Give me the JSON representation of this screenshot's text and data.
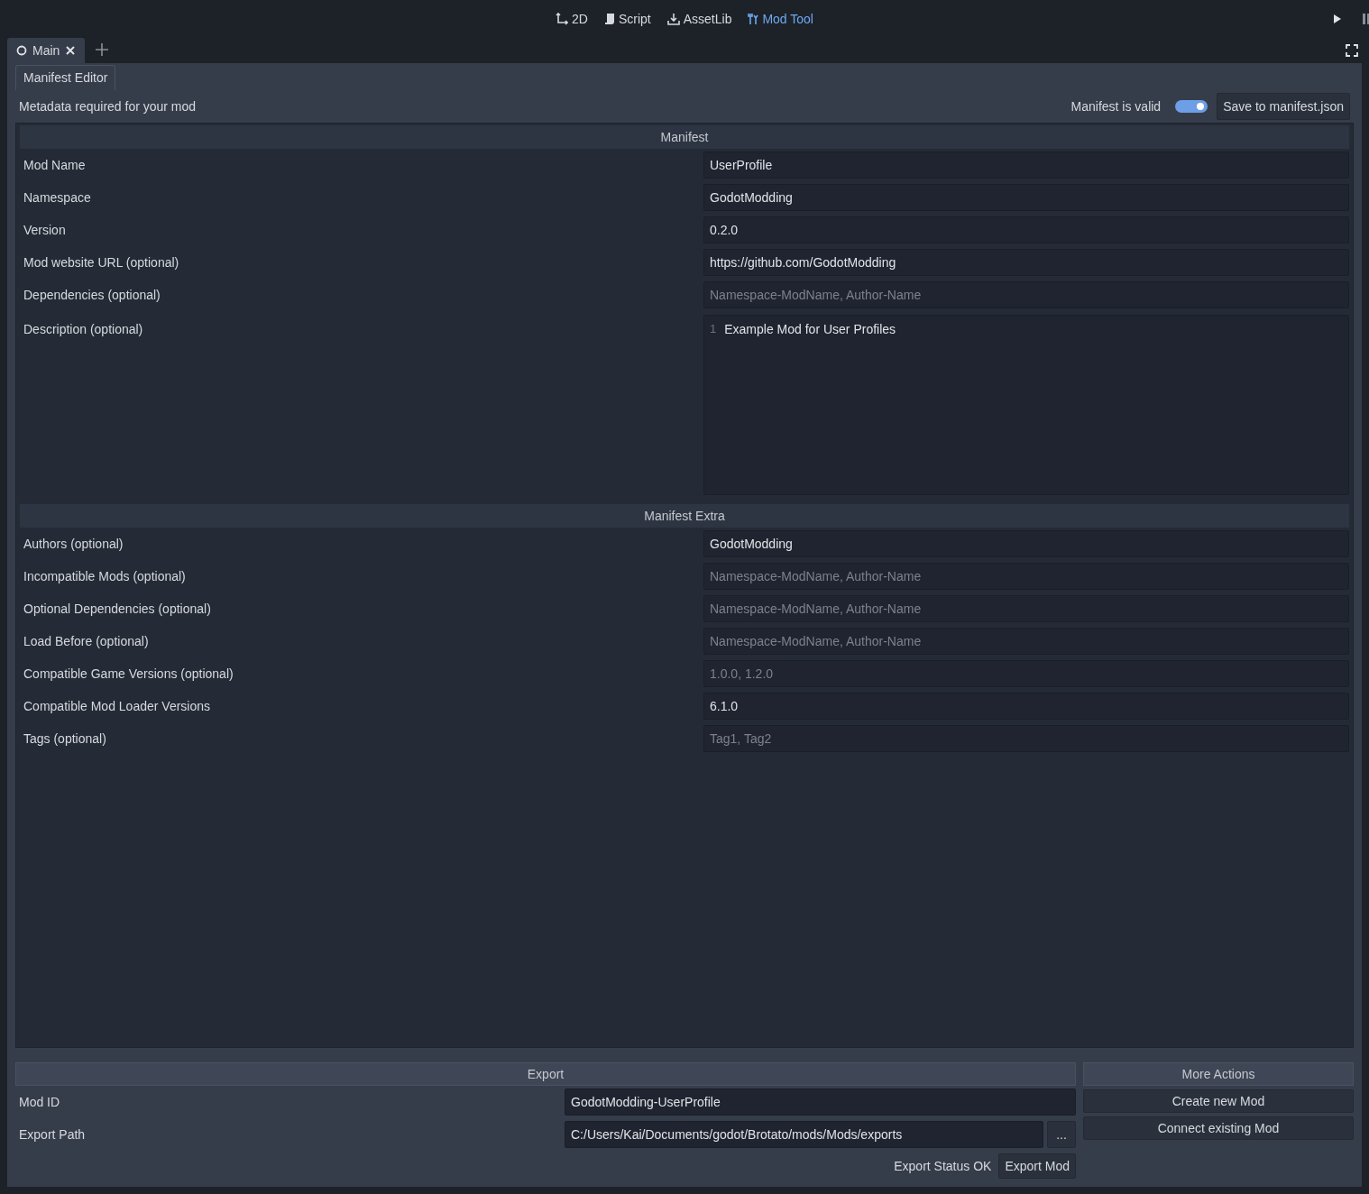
{
  "toolbar": {
    "items": [
      {
        "label": "2D",
        "kind": "axes",
        "selected": false
      },
      {
        "label": "Script",
        "kind": "script",
        "selected": false
      },
      {
        "label": "AssetLib",
        "kind": "assetlib",
        "selected": false
      },
      {
        "label": "Mod Tool",
        "kind": "modtool",
        "selected": true
      }
    ]
  },
  "scene_tabs": [
    {
      "label": "Main",
      "selected": true
    }
  ],
  "editor_tabs": [
    {
      "label": "Manifest Editor",
      "selected": true
    }
  ],
  "header": {
    "text": "Metadata required for your mod",
    "valid_label": "Manifest is valid",
    "valid_on": true,
    "save_button": "Save to manifest.json"
  },
  "sections": [
    {
      "title": "Manifest",
      "fields": [
        {
          "kind": "line",
          "label": "Mod Name",
          "value": "UserProfile"
        },
        {
          "kind": "line",
          "label": "Namespace",
          "value": "GodotModding"
        },
        {
          "kind": "line",
          "label": "Version",
          "value": "0.2.0"
        },
        {
          "kind": "line",
          "label": "Mod website URL (optional)",
          "value": "https://github.com/GodotModding"
        },
        {
          "kind": "line",
          "label": "Dependencies (optional)",
          "placeholder": "Namespace-ModName, Author-Name"
        },
        {
          "kind": "text",
          "label": "Description (optional)",
          "line_number": "1",
          "value": "Example Mod for User Profiles"
        }
      ]
    },
    {
      "title": "Manifest Extra",
      "fields": [
        {
          "kind": "line",
          "label": "Authors (optional)",
          "value": "GodotModding"
        },
        {
          "kind": "line",
          "label": "Incompatible Mods (optional)",
          "placeholder": "Namespace-ModName, Author-Name"
        },
        {
          "kind": "line",
          "label": "Optional Dependencies (optional)",
          "placeholder": "Namespace-ModName, Author-Name"
        },
        {
          "kind": "line",
          "label": "Load Before (optional)",
          "placeholder": "Namespace-ModName, Author-Name"
        },
        {
          "kind": "line",
          "label": "Compatible Game Versions (optional)",
          "placeholder": "1.0.0, 1.2.0"
        },
        {
          "kind": "line",
          "label": "Compatible Mod Loader Versions",
          "value": "6.1.0"
        },
        {
          "kind": "line",
          "label": "Tags (optional)",
          "placeholder": "Tag1, Tag2"
        }
      ]
    }
  ],
  "export": {
    "title": "Export",
    "mod_id_label": "Mod ID",
    "mod_id": "GodotModding-UserProfile",
    "path_label": "Export Path",
    "path": "C:/Users/Kai/Documents/godot/Brotato/mods/Mods/exports",
    "browse_button": "...",
    "status": "Export Status OK",
    "export_button": "Export Mod"
  },
  "more_actions": {
    "title": "More Actions",
    "buttons": [
      "Create new Mod",
      "Connect existing Mod"
    ]
  }
}
